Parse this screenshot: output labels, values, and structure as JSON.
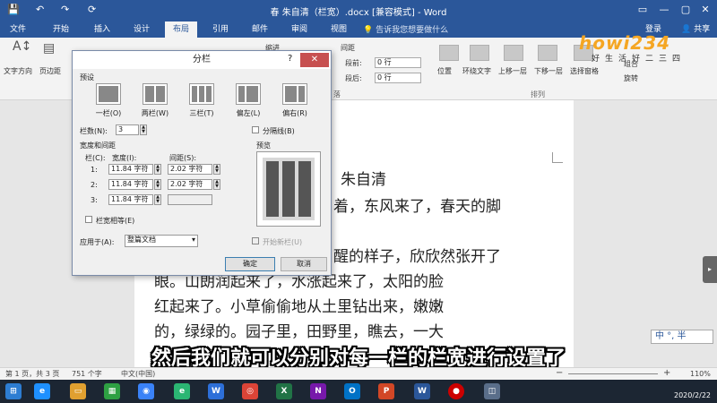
{
  "window": {
    "title": "春 朱自清（栏宽）.docx [兼容模式] - Word",
    "login": "登录",
    "share": "共享"
  },
  "tabs": [
    "文件",
    "开始",
    "插入",
    "设计",
    "布局",
    "引用",
    "邮件",
    "审阅",
    "视图"
  ],
  "tell_me": "告诉我您想要做什么",
  "ribbon": {
    "text_direction": "文字方向",
    "margins": "页边距",
    "indent_label": "缩进",
    "spacing_label": "间距",
    "before_label": "段前:",
    "before_value": "0 行",
    "after_label": "段后:",
    "after_value": "0 行",
    "group_paragraph": "落",
    "group_arrange": "排列",
    "position": "位置",
    "wrap_text": "环绕文字",
    "bring_forward": "上移一层",
    "send_backward": "下移一层",
    "selection_pane": "选择窗格",
    "group": "组合",
    "rotate": "旋转"
  },
  "dialog": {
    "title": "分栏",
    "help": "?",
    "close": "✕",
    "presets_label": "预设",
    "presets": [
      "一栏(O)",
      "两栏(W)",
      "三栏(T)",
      "偏左(L)",
      "偏右(R)"
    ],
    "num_cols_label": "栏数(N):",
    "num_cols_value": "3",
    "line_between": "分隔线(B)",
    "width_spacing_label": "宽度和间距",
    "preview_label": "预览",
    "col_header": "栏(C):",
    "width_header": "宽度(I):",
    "spacing_header": "间距(S):",
    "rows": [
      {
        "col": "1:",
        "width": "11.84 字符",
        "spacing": "2.02 字符"
      },
      {
        "col": "2:",
        "width": "11.84 字符",
        "spacing": "2.02 字符"
      },
      {
        "col": "3:",
        "width": "11.84 字符",
        "spacing": ""
      }
    ],
    "equal_width": "栏宽相等(E)",
    "apply_to_label": "应用于(A):",
    "apply_to_value": "整篇文档",
    "new_column": "开始新栏(U)",
    "ok": "确定",
    "cancel": "取消"
  },
  "document": {
    "title": "朱自清",
    "line1": "盼望着，东风来了，春天的脚",
    "line1_visible": "着，东风来了，春天的脚",
    "line2_visible": "醒的样子，欣欣然张开了",
    "line3": "眼。山朗润起来了，水涨起来了，太阳的脸",
    "line4": "红起来了。小草偷偷地从土里钻出来，嫩嫩",
    "line5": "的，绿绿的。园子里，田野里，瞧去，一大"
  },
  "subtitle": "然后我们就可以分别对每一栏的栏宽进行设置了",
  "status": {
    "page": "第 1 页，共 3 页",
    "words": "751 个字",
    "lang": "中文(中国)",
    "zoom": "110%"
  },
  "ime": "中 °, 半",
  "logo": "howi234",
  "logo_sub": "好生活好二三四",
  "taskbar_date": "2020/2/22"
}
